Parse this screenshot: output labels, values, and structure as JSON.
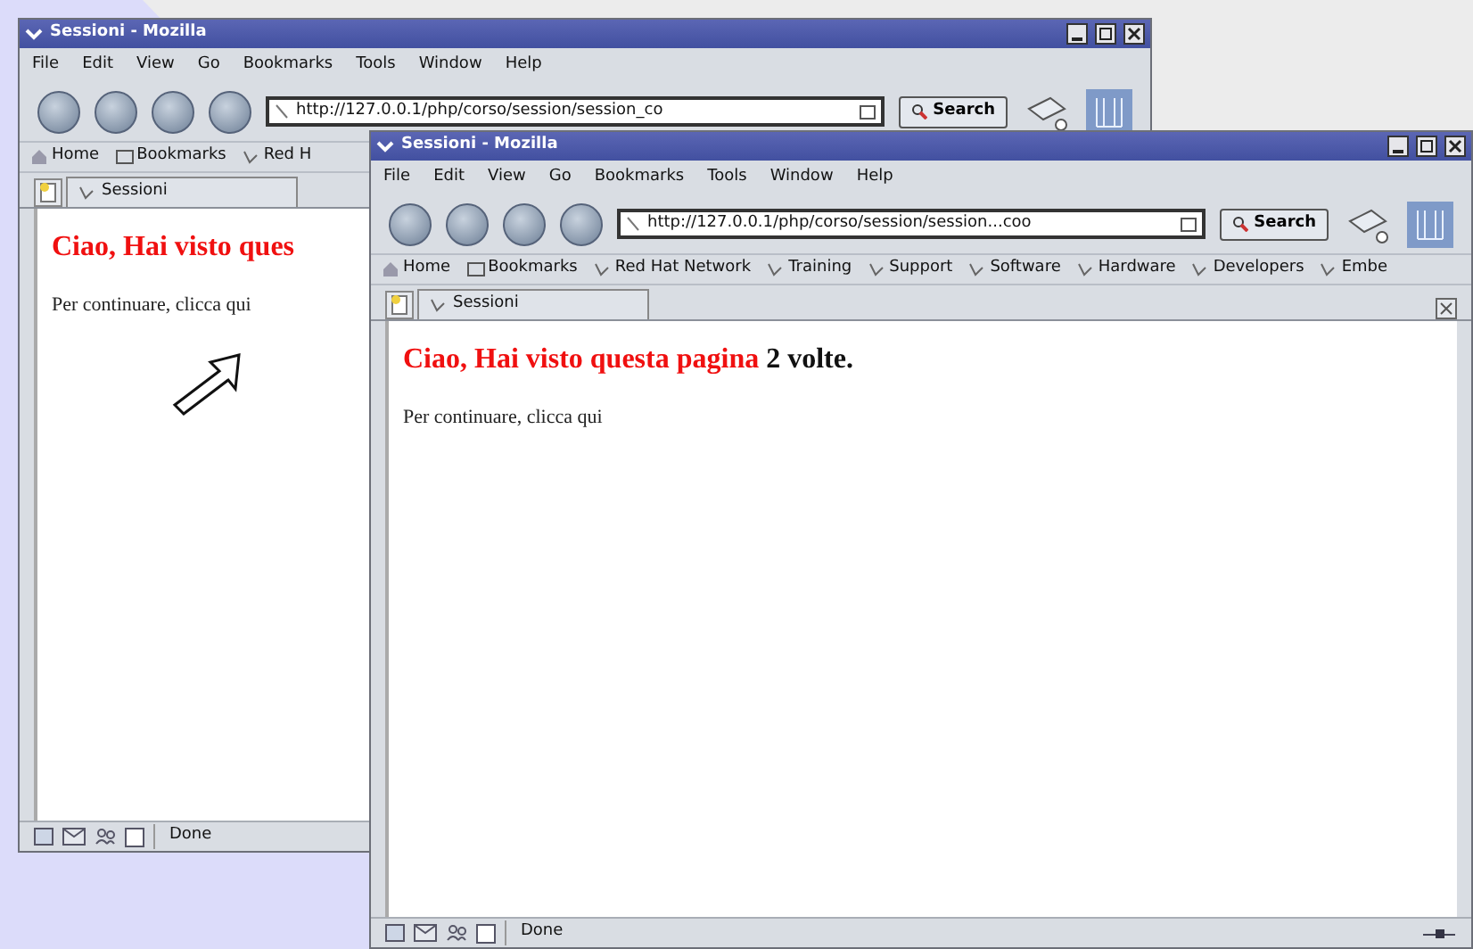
{
  "windows": [
    {
      "title": "Sessioni - Mozilla",
      "menu": [
        "File",
        "Edit",
        "View",
        "Go",
        "Bookmarks",
        "Tools",
        "Window",
        "Help"
      ],
      "url": "http://127.0.0.1/php/corso/session/session_co",
      "search_button": "Search",
      "bookmarks": [
        "Home",
        "Bookmarks",
        "Red H"
      ],
      "tabs": [
        {
          "label": "Sessioni",
          "selected": true
        }
      ],
      "heading": "Ciao, Hai visto ques",
      "intro": "Per continuare,",
      "link": "clicca qui",
      "status": "Done",
      "pointer": true
    },
    {
      "title": "Sessioni - Mozilla",
      "menu": [
        "File",
        "Edit",
        "View",
        "Go",
        "Bookmarks",
        "Tools",
        "Window",
        "Help"
      ],
      "url": "http://127.0.0.1/php/corso/session/session...coo",
      "search_button": "Search",
      "bookmarks": [
        "Home",
        "Bookmarks",
        "Red Hat Network",
        "Training",
        "Support",
        "Software",
        "Hardware",
        "Developers",
        "Embe"
      ],
      "tabs": [
        {
          "label": "Sessioni",
          "selected": true
        }
      ],
      "heading": "Ciao, Hai visto questa pagina",
      "heading_count": "2 volte.",
      "intro": "Per continuare,",
      "link": "clicca qui",
      "status": "Done",
      "pointer": false
    }
  ]
}
